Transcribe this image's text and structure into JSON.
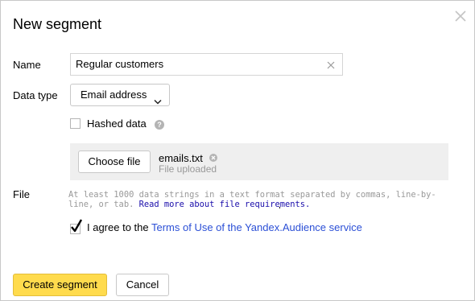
{
  "dialog": {
    "title": "New segment"
  },
  "form": {
    "name_label": "Name",
    "name_value": "Regular customers",
    "data_type_label": "Data type",
    "data_type_value": "Email address",
    "hashed_label": "Hashed data",
    "hashed_checked": false,
    "help_glyph": "?",
    "file_label": "File",
    "choose_file_label": "Choose file",
    "file_name": "emails.txt",
    "file_status": "File uploaded",
    "hint_text": "At least 1000 data strings in a text format separated by commas, line-by-line, or tab. ",
    "hint_link": "Read more about file requirements.",
    "agree_prefix": "I agree to the ",
    "agree_link": "Terms of Use of the Yandex.Audience service",
    "agree_checked": true
  },
  "footer": {
    "create_label": "Create segment",
    "cancel_label": "Cancel"
  },
  "colors": {
    "accent_button": "#ffdb4d",
    "link": "#2b4fd6",
    "checkmark": "#000000"
  },
  "icons": [
    "close-icon",
    "clear-input-icon",
    "chevron-down-icon",
    "help-icon",
    "remove-file-icon",
    "checkmark-icon"
  ]
}
